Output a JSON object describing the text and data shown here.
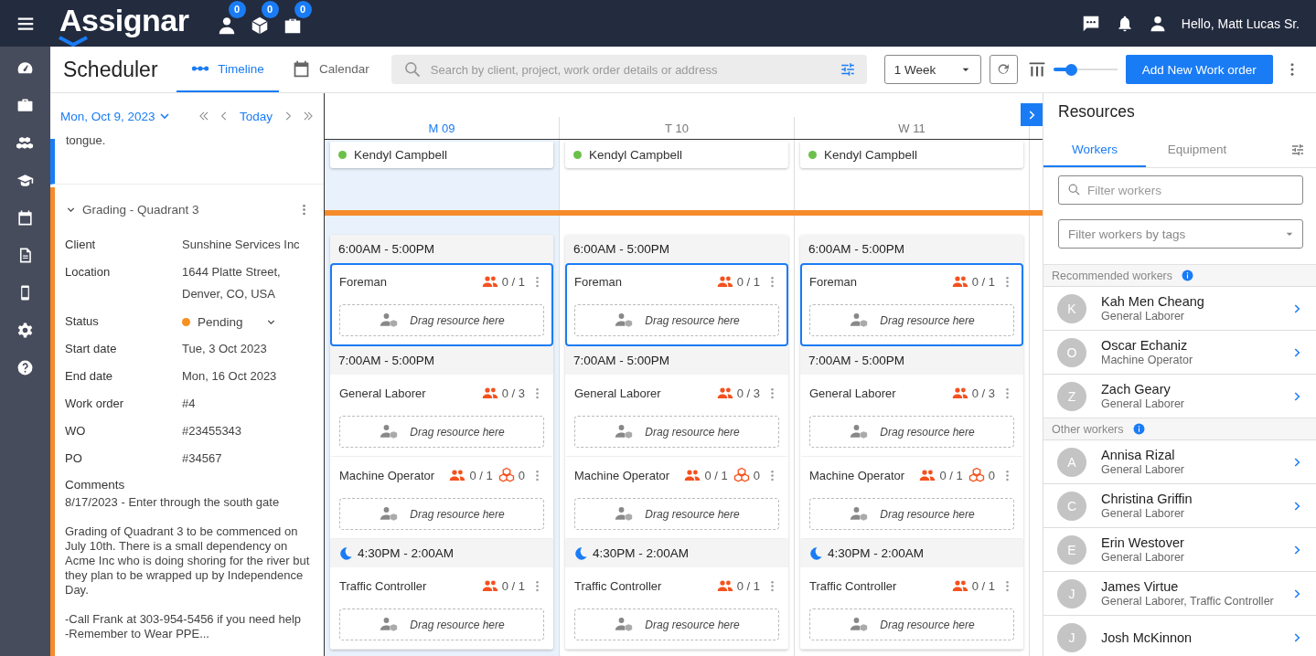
{
  "top_bar": {
    "logo": "Assignar",
    "badges": [
      {
        "kind": "person",
        "count": "0"
      },
      {
        "kind": "cube",
        "count": "0"
      },
      {
        "kind": "bag",
        "count": "0"
      }
    ],
    "greeting": "Hello, Matt Lucas Sr."
  },
  "header": {
    "title": "Scheduler",
    "tabs": [
      {
        "label": "Timeline",
        "kind": "timeline",
        "selected": true
      },
      {
        "label": "Calendar",
        "kind": "calendar",
        "selected": false
      }
    ],
    "search": {
      "placeholder": "Search by client, project, work order details or address"
    },
    "range": "1 Week",
    "zoom": {
      "level": 0.28
    },
    "add_button": "Add New Work order"
  },
  "date_nav": {
    "date": "Mon, Oct 9, 2023",
    "today": "Today"
  },
  "prev_card": {
    "text": "tongue."
  },
  "work_order": {
    "title": "Grading - Quadrant 3",
    "expanded": true,
    "fields": [
      {
        "label": "Client",
        "value": "Sunshine Services Inc"
      },
      {
        "label": "Location",
        "value": "1644 Platte Street, Denver, CO, USA"
      },
      {
        "label": "Status",
        "value": "Pending",
        "kind": "status",
        "color": "#f7901e"
      },
      {
        "label": "Start date",
        "value": "Tue, 3 Oct 2023"
      },
      {
        "label": "End date",
        "value": "Mon, 16 Oct 2023"
      },
      {
        "label": "Work order",
        "value": "#4"
      },
      {
        "label": "WO",
        "value": "#23455343"
      },
      {
        "label": "PO",
        "value": "#34567"
      }
    ],
    "comments_label": "Comments",
    "comments": [
      "8/17/2023 - Enter through the south gate",
      "Grading of Quadrant 3 to be commenced on July 10th.  There is a small dependency on Acme Inc who is doing shoring for the river but they plan to be wrapped up by Independence Day.",
      "-Call Frank at 303-954-5456 if you need help\n-Remember to Wear PPE..."
    ]
  },
  "columns": [
    {
      "label": "M 09",
      "selected": true,
      "assignment": {
        "name": "Kendyl Campbell",
        "color": "#6cc04a"
      },
      "shifts": [
        {
          "time": "6:00AM - 5:00PM",
          "kind": "day",
          "roles": [
            {
              "name": "Foreman",
              "count": "0 / 1",
              "highlighted": true,
              "drop": "Drag resource here"
            }
          ]
        },
        {
          "time": "7:00AM - 5:00PM",
          "kind": "day",
          "roles": [
            {
              "name": "General Laborer",
              "count": "0 / 3",
              "highlighted": false,
              "drop": "Drag resource here"
            },
            {
              "name": "Machine Operator",
              "count": "0 / 1",
              "equipment": "0",
              "highlighted": false,
              "drop": "Drag resource here"
            }
          ]
        },
        {
          "time": "4:30PM - 2:00AM",
          "kind": "night",
          "roles": [
            {
              "name": "Traffic Controller",
              "count": "0 / 1",
              "highlighted": false,
              "drop": "Drag resource here"
            }
          ]
        }
      ]
    },
    {
      "label": "T 10",
      "selected": false,
      "assignment": {
        "name": "Kendyl Campbell",
        "color": "#6cc04a"
      },
      "shifts": [
        {
          "time": "6:00AM - 5:00PM",
          "kind": "day",
          "roles": [
            {
              "name": "Foreman",
              "count": "0 / 1",
              "highlighted": true,
              "drop": "Drag resource here"
            }
          ]
        },
        {
          "time": "7:00AM - 5:00PM",
          "kind": "day",
          "roles": [
            {
              "name": "General Laborer",
              "count": "0 / 3",
              "highlighted": false,
              "drop": "Drag resource here"
            },
            {
              "name": "Machine Operator",
              "count": "0 / 1",
              "equipment": "0",
              "highlighted": false,
              "drop": "Drag resource here"
            }
          ]
        },
        {
          "time": "4:30PM - 2:00AM",
          "kind": "night",
          "roles": [
            {
              "name": "Traffic Controller",
              "count": "0 / 1",
              "highlighted": false,
              "drop": "Drag resource here"
            }
          ]
        }
      ]
    },
    {
      "label": "W 11",
      "selected": false,
      "assignment": {
        "name": "Kendyl Campbell",
        "color": "#6cc04a"
      },
      "shifts": [
        {
          "time": "6:00AM - 5:00PM",
          "kind": "day",
          "roles": [
            {
              "name": "Foreman",
              "count": "0 / 1",
              "highlighted": true,
              "drop": "Drag resource here"
            }
          ]
        },
        {
          "time": "7:00AM - 5:00PM",
          "kind": "day",
          "roles": [
            {
              "name": "General Laborer",
              "count": "0 / 3",
              "highlighted": false,
              "drop": "Drag resource here"
            },
            {
              "name": "Machine Operator",
              "count": "0 / 1",
              "equipment": "0",
              "highlighted": false,
              "drop": "Drag resource here"
            }
          ]
        },
        {
          "time": "4:30PM - 2:00AM",
          "kind": "night",
          "roles": [
            {
              "name": "Traffic Controller",
              "count": "0 / 1",
              "highlighted": false,
              "drop": "Drag resource here"
            }
          ]
        }
      ]
    }
  ],
  "resources": {
    "title": "Resources",
    "tabs": [
      {
        "label": "Workers",
        "selected": true
      },
      {
        "label": "Equipment",
        "selected": false
      }
    ],
    "filter": {
      "placeholder": "Filter workers"
    },
    "tags": {
      "placeholder": "Filter workers by tags"
    },
    "groups": [
      {
        "title": "Recommended workers",
        "workers": [
          {
            "initial": "K",
            "name": "Kah Men Cheang",
            "role": "General Laborer"
          },
          {
            "initial": "O",
            "name": "Oscar Echaniz",
            "role": "Machine Operator"
          },
          {
            "initial": "Z",
            "name": "Zach Geary",
            "role": "General Laborer"
          }
        ]
      },
      {
        "title": "Other workers",
        "workers": [
          {
            "initial": "A",
            "name": "Annisa Rizal",
            "role": "General Laborer"
          },
          {
            "initial": "C",
            "name": "Christina Griffin",
            "role": "General Laborer"
          },
          {
            "initial": "E",
            "name": "Erin Westover",
            "role": "General Laborer"
          },
          {
            "initial": "J",
            "name": "James Virtue",
            "role": "General Laborer, Traffic Controller"
          },
          {
            "initial": "J",
            "name": "Josh McKinnon"
          }
        ]
      }
    ]
  }
}
